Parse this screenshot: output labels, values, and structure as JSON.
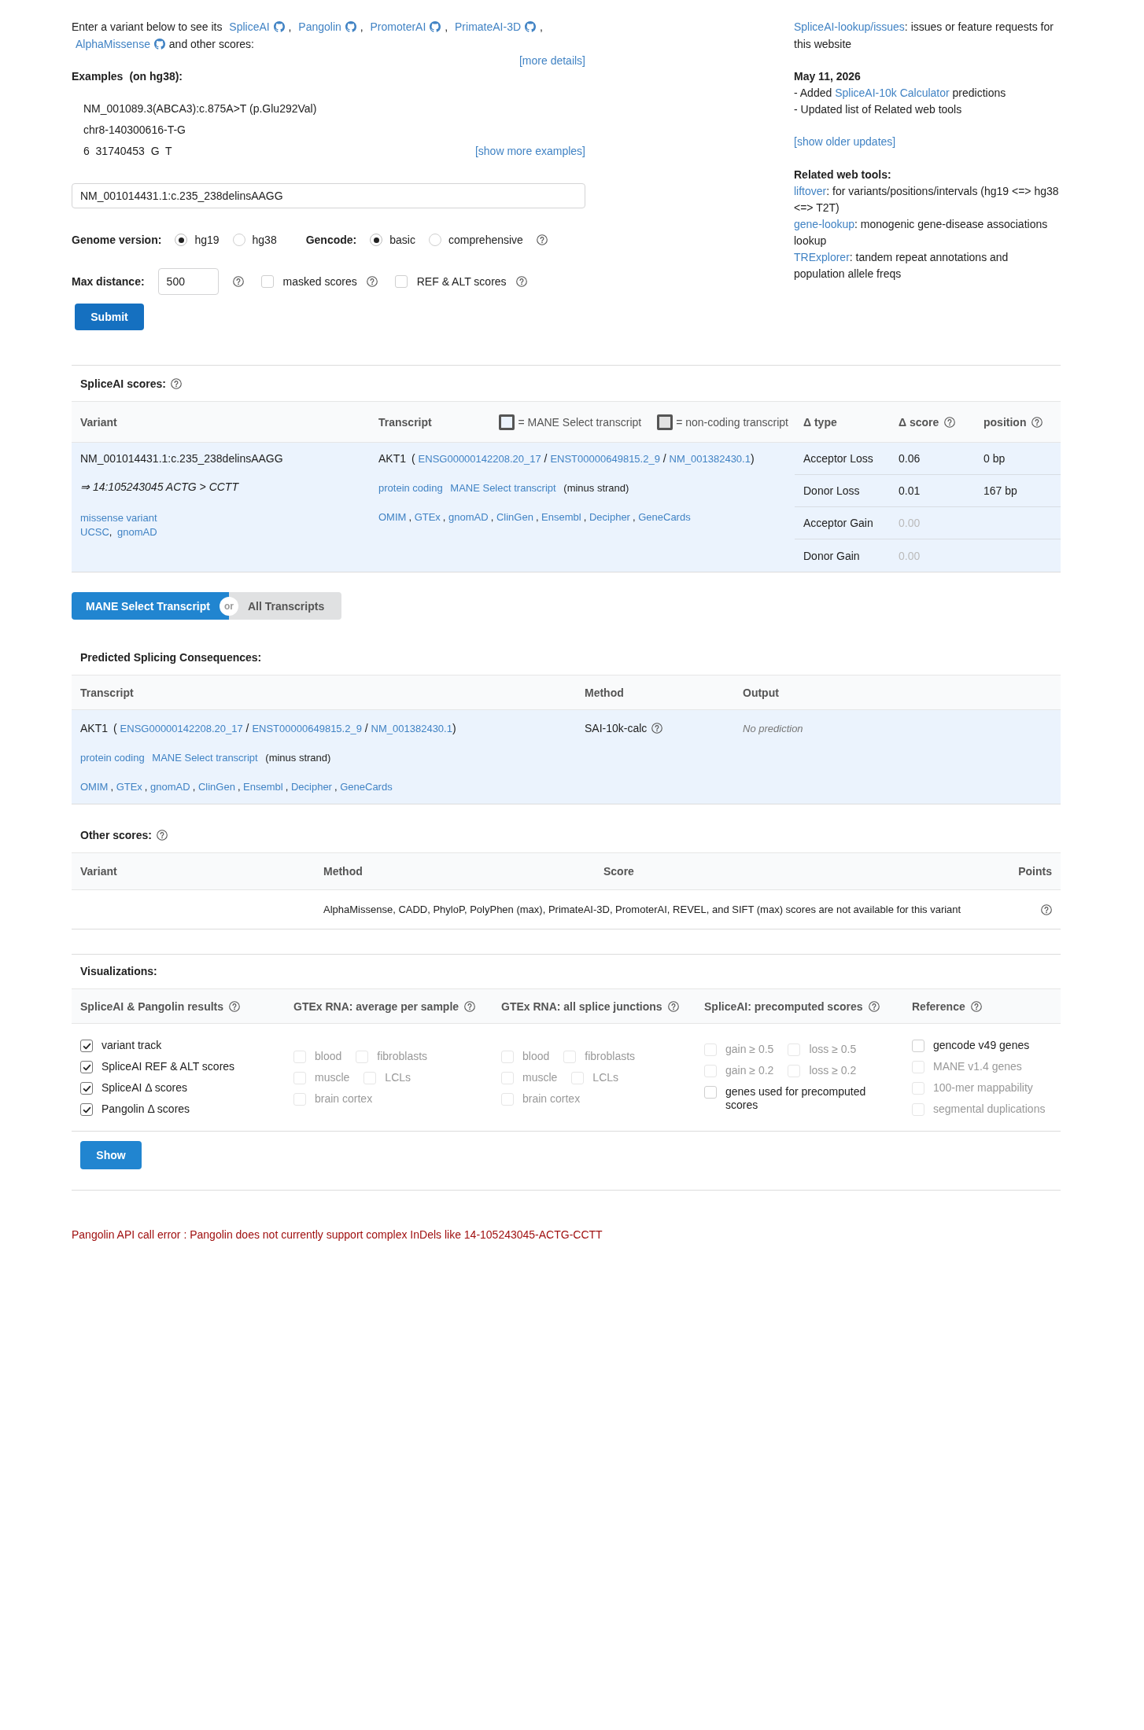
{
  "intro": {
    "lead": "Enter a variant below to see its",
    "tools": [
      {
        "label": "SpliceAI",
        "separator": ","
      },
      {
        "label": "Pangolin",
        "separator": ","
      },
      {
        "label": "PromoterAI",
        "separator": ","
      },
      {
        "label": "PrimateAI-3D",
        "separator": ","
      },
      {
        "label": "AlphaMissense"
      }
    ],
    "tail": "and other scores:",
    "more_details": "[more details]"
  },
  "examples": {
    "title": "Examples",
    "note": "(on hg38):",
    "items": [
      "NM_001089.3(ABCA3):c.875A>T (p.Glu292Val)",
      "chr8-140300616-T-G",
      "6  31740453  G  T"
    ],
    "more": "[show more examples]"
  },
  "variant_field": {
    "value": "NM_001014431.1:c.235_238delinsAAGG"
  },
  "genome_version": {
    "label": "Genome version:",
    "options": [
      {
        "label": "hg19",
        "selected": true
      },
      {
        "label": "hg38",
        "selected": false
      }
    ]
  },
  "gencode": {
    "label": "Gencode:",
    "options": [
      {
        "label": "basic",
        "selected": true
      },
      {
        "label": "comprehensive",
        "selected": false
      }
    ],
    "help": true
  },
  "max_distance": {
    "label": "Max distance:",
    "value": "500",
    "help": true
  },
  "score_options": [
    {
      "label": "masked scores",
      "checked": false,
      "help": true
    },
    {
      "label": "REF & ALT scores",
      "checked": false,
      "help": true
    }
  ],
  "submit": "Submit",
  "sidebar": {
    "issues": {
      "link": "SpliceAI-lookup/issues",
      "text": ": issues or feature requests for this website"
    },
    "update": {
      "date": "May 11, 2026",
      "lines": [
        {
          "before": "- Added ",
          "link": "SpliceAI-10k Calculator",
          "after": " predictions"
        },
        {
          "before": "- Updated list of Related web tools"
        }
      ]
    },
    "older": "[show older updates]",
    "related": {
      "title": "Related web tools:",
      "items": [
        {
          "link": "liftover",
          "text": ": for variants/positions/intervals (hg19 <=> hg38 <=> T2T)"
        },
        {
          "link": "gene-lookup",
          "text": ": monogenic gene-disease associations lookup"
        },
        {
          "link": "TRExplorer",
          "text": ": tandem repeat annotations and population allele freqs"
        }
      ]
    }
  },
  "spliceai_scores": {
    "title": "SpliceAI scores:",
    "help": true,
    "columns": [
      {
        "label": "Variant",
        "help": false
      },
      {
        "label": "Transcript",
        "help": false
      },
      {
        "label": "Δ type",
        "help": false
      },
      {
        "label": "Δ score",
        "help": true
      },
      {
        "label": "position",
        "help": true
      }
    ],
    "legend": [
      {
        "kind": "mane",
        "label": "= MANE Select transcript"
      },
      {
        "kind": "noncoding",
        "label": "= non-coding transcript"
      }
    ],
    "mane_select": true,
    "variant": {
      "name": "NM_001014431.1:c.235_238delinsAAGG",
      "coords": "⇒ 14:105243045 ACTG > CCTT",
      "consequence": "missense variant",
      "links": {
        "separator": ",",
        "items": [
          "UCSC",
          "gnomAD"
        ]
      }
    },
    "transcript": {
      "gene": "AKT1",
      "ids": {
        "open": "(",
        "separator": "/",
        "close": ")",
        "items": [
          "ENSG00000142208.20_17",
          "ENST00000649815.2_9",
          "NM_001382430.1"
        ]
      },
      "tags": [
        "protein coding",
        "MANE Select transcript"
      ],
      "strand": "(minus strand)",
      "links": {
        "separator": ",",
        "items": [
          "OMIM",
          "GTEx",
          "gnomAD",
          "ClinGen",
          "Ensembl",
          "Decipher",
          "GeneCards"
        ]
      }
    },
    "rows": [
      {
        "type": "Acceptor Loss",
        "score": "0.06",
        "position": "0 bp",
        "faded": false
      },
      {
        "type": "Donor Loss",
        "score": "0.01",
        "position": "167 bp",
        "faded": false
      },
      {
        "type": "Acceptor Gain",
        "score": "0.00",
        "faded": true
      },
      {
        "type": "Donor Gain",
        "score": "0.00",
        "faded": true
      }
    ]
  },
  "transcript_toggle": {
    "options": [
      {
        "label": "MANE Select Transcript",
        "selected": true
      },
      {
        "label": "All Transcripts",
        "selected": false
      }
    ],
    "divider": "or"
  },
  "predicted": {
    "title": "Predicted Splicing Consequences:",
    "columns": [
      "Transcript",
      "Method",
      "Output"
    ],
    "mane_select": true,
    "transcript": {
      "gene": "AKT1",
      "ids": {
        "open": "(",
        "separator": "/",
        "close": ")",
        "items": [
          "ENSG00000142208.20_17",
          "ENST00000649815.2_9",
          "NM_001382430.1"
        ]
      },
      "tags": [
        "protein coding",
        "MANE Select transcript"
      ],
      "strand": "(minus strand)",
      "links": {
        "separator": ",",
        "items": [
          "OMIM",
          "GTEx",
          "gnomAD",
          "ClinGen",
          "Ensembl",
          "Decipher",
          "GeneCards"
        ]
      }
    },
    "method": {
      "label": "SAI-10k-calc",
      "help": true
    },
    "output": "No prediction"
  },
  "other_scores": {
    "title": "Other scores:",
    "help": true,
    "columns": [
      "Variant",
      "Method",
      "Score",
      "Points"
    ],
    "note": "AlphaMissense, CADD, PhyloP, PolyPhen (max), PrimateAI-3D, PromoterAI, REVEL, and SIFT (max) scores are not available for this variant",
    "note_help": true
  },
  "visualizations": {
    "title": "Visualizations:",
    "groups": [
      {
        "title": "SpliceAI & Pangolin results",
        "help": true,
        "rows": [
          [
            {
              "label": "variant track",
              "checked": true,
              "disabled": false
            }
          ],
          [
            {
              "label": "SpliceAI REF & ALT scores",
              "checked": true,
              "disabled": false
            }
          ],
          [
            {
              "label": "SpliceAI Δ scores",
              "checked": true,
              "disabled": false
            }
          ],
          [
            {
              "label": "Pangolin Δ scores",
              "checked": true,
              "disabled": false
            }
          ]
        ]
      },
      {
        "title": "GTEx RNA: average per sample",
        "help": true,
        "rows": [
          [
            {
              "label": "blood",
              "checked": false,
              "disabled": true
            },
            {
              "label": "fibroblasts",
              "checked": false,
              "disabled": true
            }
          ],
          [
            {
              "label": "muscle",
              "checked": false,
              "disabled": true
            },
            {
              "label": "LCLs",
              "checked": false,
              "disabled": true
            }
          ],
          [
            {
              "label": "brain cortex",
              "checked": false,
              "disabled": true
            }
          ]
        ]
      },
      {
        "title": "GTEx RNA: all splice junctions",
        "help": true,
        "rows": [
          [
            {
              "label": "blood",
              "checked": false,
              "disabled": true
            },
            {
              "label": "fibroblasts",
              "checked": false,
              "disabled": true
            }
          ],
          [
            {
              "label": "muscle",
              "checked": false,
              "disabled": true
            },
            {
              "label": "LCLs",
              "checked": false,
              "disabled": true
            }
          ],
          [
            {
              "label": "brain cortex",
              "checked": false,
              "disabled": true
            }
          ]
        ]
      },
      {
        "title": "SpliceAI: precomputed scores",
        "help": true,
        "rows": [
          [
            {
              "label": "gain ≥ 0.5",
              "checked": false,
              "disabled": true
            },
            {
              "label": "loss ≥ 0.5",
              "checked": false,
              "disabled": true
            }
          ],
          [
            {
              "label": "gain ≥ 0.2",
              "checked": false,
              "disabled": true
            },
            {
              "label": "loss ≥ 0.2",
              "checked": false,
              "disabled": true
            }
          ],
          [
            {
              "label": "genes used for precomputed scores",
              "checked": false,
              "disabled": false
            }
          ]
        ]
      },
      {
        "title": "Reference",
        "help": true,
        "rows": [
          [
            {
              "label": "gencode v49 genes",
              "checked": false,
              "disabled": false
            }
          ],
          [
            {
              "label": "MANE v1.4 genes",
              "checked": false,
              "disabled": true
            }
          ],
          [
            {
              "label": "100-mer mappability",
              "checked": false,
              "disabled": true
            }
          ],
          [
            {
              "label": "segmental duplications",
              "checked": false,
              "disabled": true
            }
          ]
        ]
      }
    ],
    "show": "Show"
  },
  "error": "Pangolin API call error : Pangolin does not currently support complex InDels like 14-105243045-ACTG-CCTT"
}
